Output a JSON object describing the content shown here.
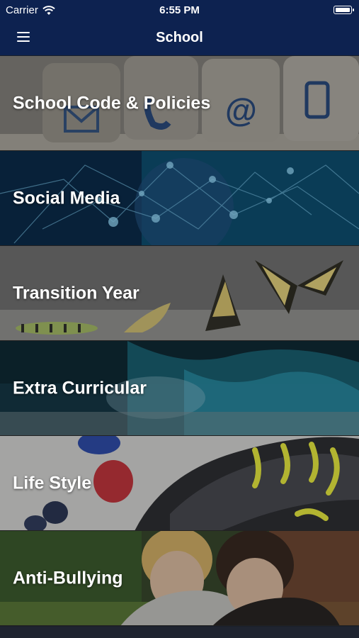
{
  "status": {
    "carrier": "Carrier",
    "time": "6:55 PM",
    "battery_level": 1.0
  },
  "nav": {
    "title": "School",
    "menu_icon": "hamburger-icon"
  },
  "rows": [
    {
      "label": "School Code & Policies"
    },
    {
      "label": "Social Media"
    },
    {
      "label": "Transition Year"
    },
    {
      "label": "Extra Curricular"
    },
    {
      "label": "Life Style"
    },
    {
      "label": "Anti-Bullying"
    }
  ],
  "colors": {
    "nav_bg": "#0d2250",
    "text": "#ffffff"
  }
}
